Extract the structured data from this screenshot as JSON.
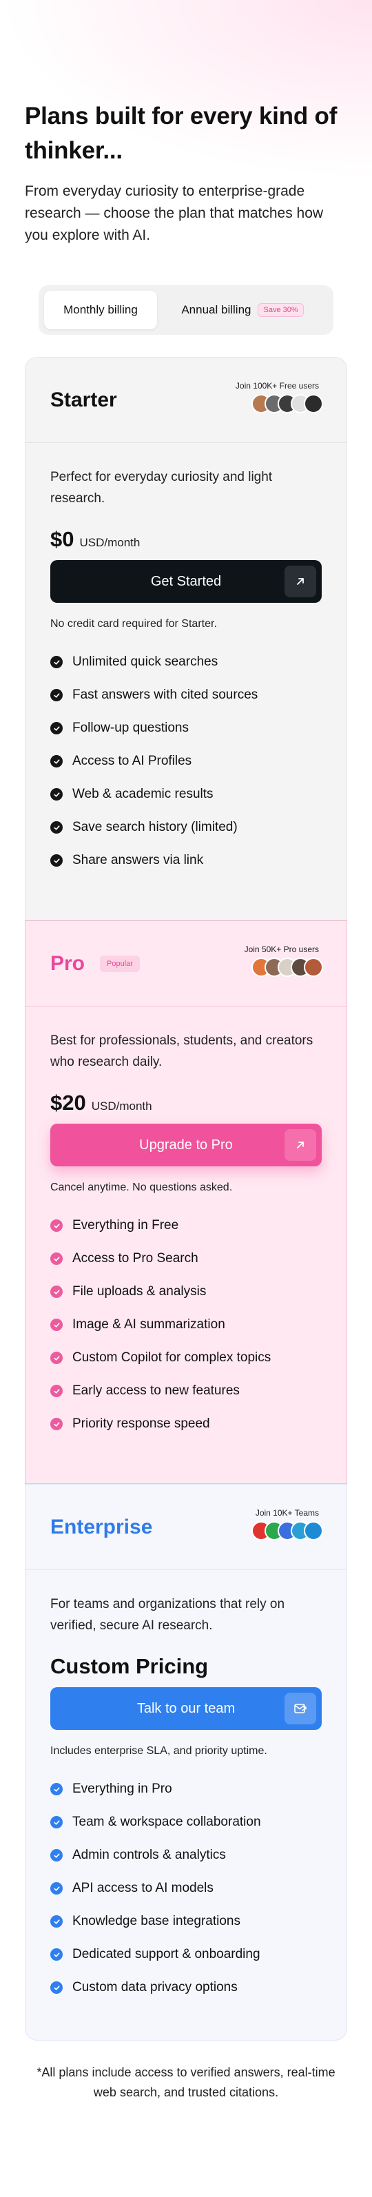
{
  "hero": {
    "title": "Plans built for every kind of thinker...",
    "subtitle": "From everyday curiosity to enterprise-grade research — choose the plan that matches how you explore with AI."
  },
  "billing": {
    "monthly_label": "Monthly billing",
    "annual_label": "Annual billing",
    "save_badge": "Save 30%",
    "selected": "Monthly billing"
  },
  "plans": {
    "starter": {
      "name": "Starter",
      "join": "Join 100K+ Free users",
      "description": "Perfect for everyday curiosity and light research.",
      "price": "$0",
      "period": "USD/month",
      "cta": "Get Started",
      "note": "No credit card required for Starter.",
      "features": [
        "Unlimited quick searches",
        "Fast answers with cited sources",
        "Follow-up questions",
        "Access to AI Profiles",
        "Web & academic results",
        "Save search history (limited)",
        "Share answers via link"
      ],
      "avatar_colors": [
        "#b7794f",
        "#6b6b6b",
        "#3c3c3c",
        "#e0e0e0",
        "#2b2b2b"
      ]
    },
    "pro": {
      "name": "Pro",
      "badge": "Popular",
      "join": "Join 50K+ Pro users",
      "description": "Best for professionals, students, and creators who research daily.",
      "price": "$20",
      "period": "USD/month",
      "cta": "Upgrade to Pro",
      "note": "Cancel anytime. No questions asked.",
      "features": [
        "Everything in Free",
        "Access to Pro Search",
        "File uploads & analysis",
        "Image & AI summarization",
        "Custom Copilot for complex topics",
        "Early access to new features",
        "Priority response speed"
      ],
      "avatar_colors": [
        "#e0763a",
        "#8c6a55",
        "#d9d0c8",
        "#5e4a3f",
        "#b35a3a"
      ]
    },
    "enterprise": {
      "name": "Enterprise",
      "join": "Join 10K+ Teams",
      "description": "For teams and organizations that rely on verified, secure AI research.",
      "price_label": "Custom Pricing",
      "cta": "Talk to our team",
      "note": "Includes enterprise SLA, and priority uptime.",
      "features": [
        "Everything in Pro",
        "Team & workspace collaboration",
        "Admin controls & analytics",
        "API access to AI models",
        "Knowledge base integrations",
        "Dedicated support & onboarding",
        "Custom data privacy options"
      ],
      "avatar_colors": [
        "#e0342f",
        "#2aa84a",
        "#3b6fe0",
        "#2a9fd6",
        "#1e8ad6"
      ]
    }
  },
  "footnote": "*All plans include access to verified answers, real-time web search, and trusted citations."
}
